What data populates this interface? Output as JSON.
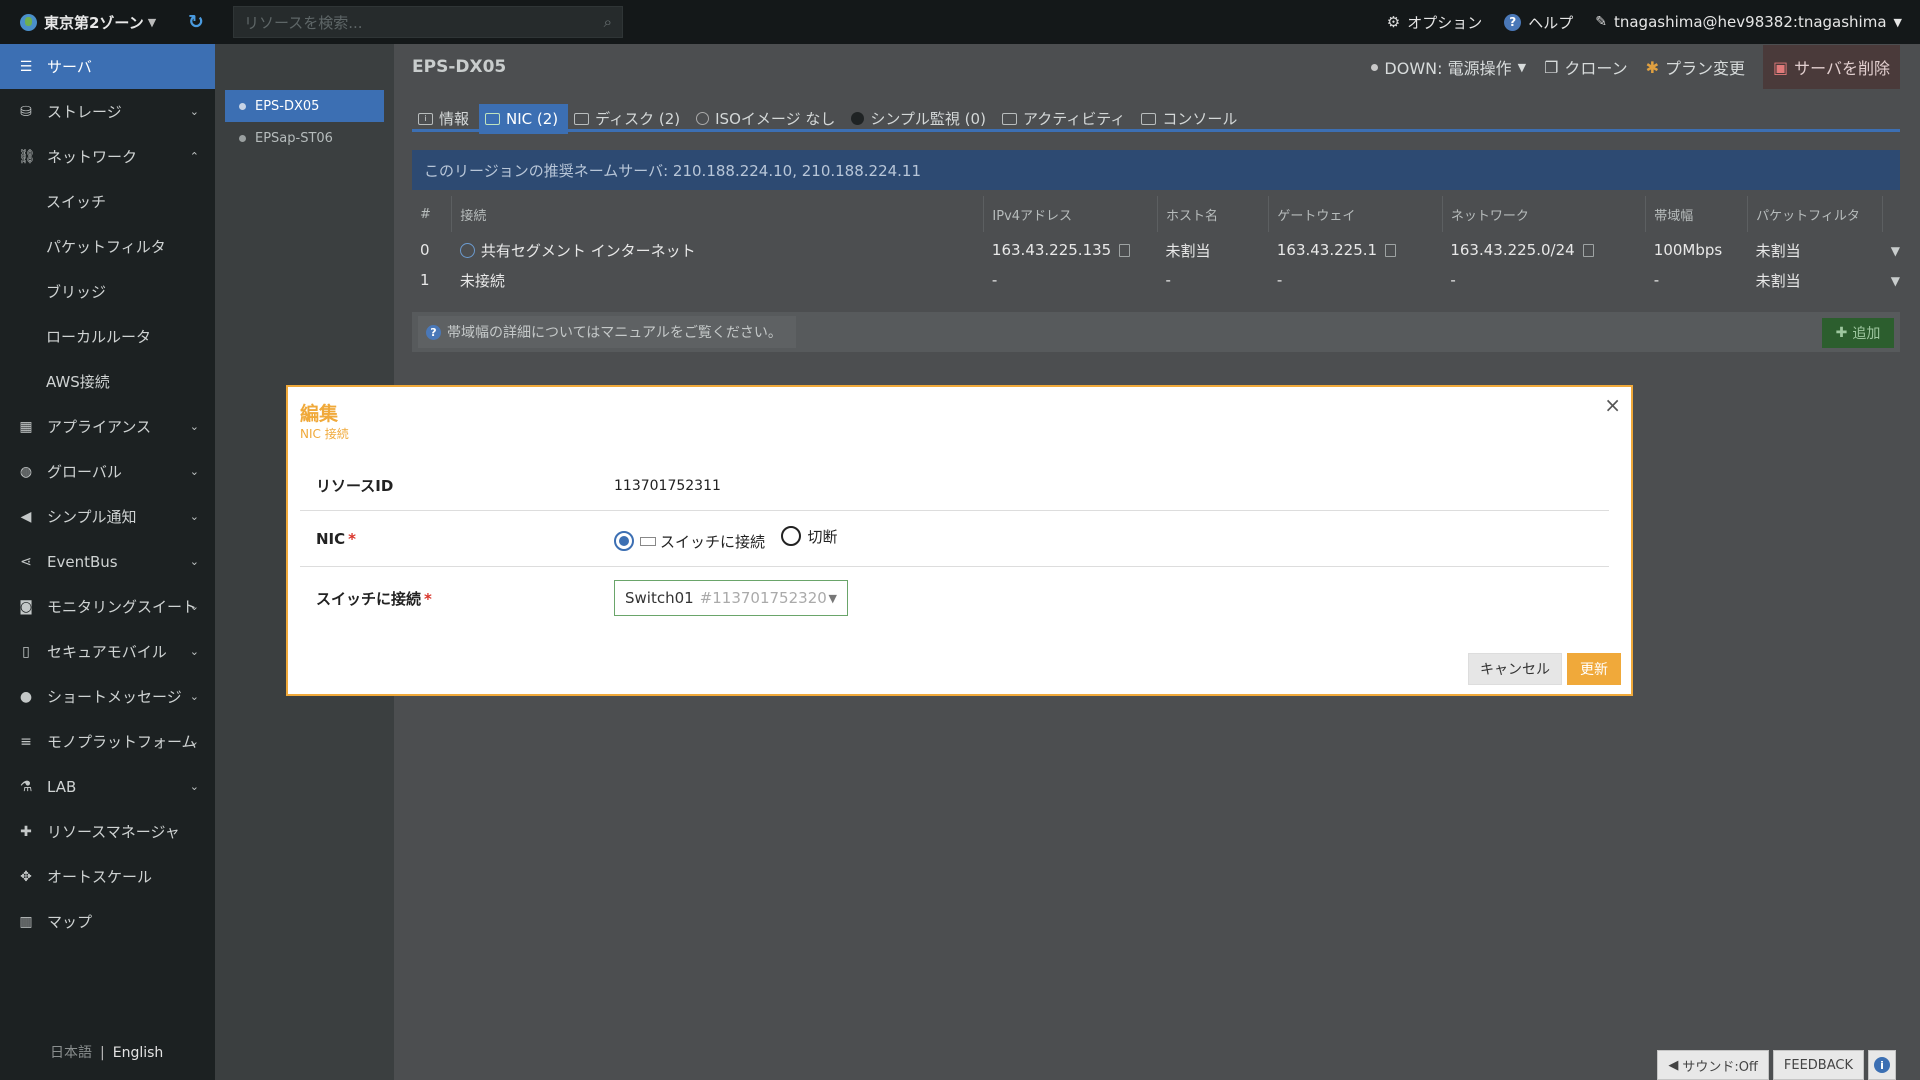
{
  "topbar": {
    "zone": "東京第2ゾーン",
    "search_placeholder": "リソースを検索...",
    "options": "オプション",
    "help": "ヘルプ",
    "user": "tnagashima@hev98382:tnagashima"
  },
  "sidebar": {
    "items": [
      {
        "label": "サーバ",
        "icon": "server-icon",
        "active": true
      },
      {
        "label": "ストレージ",
        "icon": "storage-icon"
      },
      {
        "label": "ネットワーク",
        "icon": "network-icon"
      },
      {
        "label": "スイッチ"
      },
      {
        "label": "パケットフィルタ"
      },
      {
        "label": "ブリッジ"
      },
      {
        "label": "ローカルルータ"
      },
      {
        "label": "AWS接続"
      },
      {
        "label": "アプライアンス",
        "icon": "appliance-icon"
      },
      {
        "label": "グローバル",
        "icon": "globe-icon"
      },
      {
        "label": "シンプル通知",
        "icon": "megaphone-icon"
      },
      {
        "label": "EventBus",
        "icon": "share-icon"
      },
      {
        "label": "モニタリングスイート",
        "icon": "binoculars-icon"
      },
      {
        "label": "セキュアモバイル",
        "icon": "mobile-icon"
      },
      {
        "label": "ショートメッセージ",
        "icon": "chat-icon"
      },
      {
        "label": "モノプラットフォーム",
        "icon": "list-icon"
      },
      {
        "label": "LAB",
        "icon": "flask-icon"
      },
      {
        "label": "リソースマネージャ",
        "icon": "puzzle-icon"
      },
      {
        "label": "オートスケール",
        "icon": "arrows-icon"
      },
      {
        "label": "マップ",
        "icon": "map-icon"
      }
    ],
    "lang_ja": "日本語",
    "lang_sep": "|",
    "lang_en": "English"
  },
  "servers": [
    "EPS-DX05",
    "EPSap-ST06"
  ],
  "main": {
    "title": "EPS-DX05",
    "status": "DOWN: 電源操作",
    "clone": "クローン",
    "plan": "プラン変更",
    "delete": "サーバを削除",
    "tabs": [
      {
        "label": "情報"
      },
      {
        "label": "NIC (2)",
        "active": true
      },
      {
        "label": "ディスク (2)"
      },
      {
        "label": "ISOイメージ なし"
      },
      {
        "label": "シンプル監視 (0)"
      },
      {
        "label": "アクティビティ"
      },
      {
        "label": "コンソール"
      }
    ],
    "banner": "このリージョンの推奨ネームサーバ: 210.188.224.10, 210.188.224.11",
    "table": {
      "headers": [
        "#",
        "接続",
        "IPv4アドレス",
        "ホスト名",
        "ゲートウェイ",
        "ネットワーク",
        "帯域幅",
        "パケットフィルタ"
      ],
      "rows": [
        [
          "0",
          "共有セグメント インターネット",
          "163.43.225.135",
          "未割当",
          "163.43.225.1",
          "163.43.225.0/24",
          "100Mbps",
          "未割当"
        ],
        [
          "1",
          "未接続",
          "-",
          "-",
          "-",
          "-",
          "-",
          "未割当"
        ]
      ]
    },
    "info": "帯域幅の詳細についてはマニュアルをご覧ください。",
    "add": "追加"
  },
  "modal": {
    "title": "編集",
    "subtitle": "NIC 接続",
    "resource_label": "リソースID",
    "resource_value": "113701752311",
    "nic_label": "NIC",
    "nic_opt1": "スイッチに接続",
    "nic_opt2": "切断",
    "switch_label": "スイッチに接続",
    "switch_value": "Switch01",
    "switch_id": "#113701752320",
    "cancel": "キャンセル",
    "update": "更新"
  },
  "footer": {
    "sound": "サウンド:Off",
    "feedback": "FEEDBACK"
  }
}
